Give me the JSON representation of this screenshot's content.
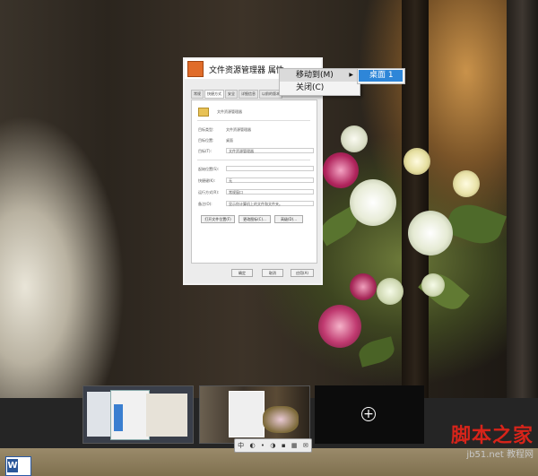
{
  "window": {
    "title": "文件资源管理器 属性",
    "tabs": [
      "常规",
      "快捷方式",
      "安全",
      "详细信息",
      "以前的版本"
    ],
    "app_name": "文件资源管理器",
    "fields": [
      {
        "label": "目标类型:",
        "value": "文件资源管理器"
      },
      {
        "label": "目标位置:",
        "value": "桌面"
      },
      {
        "label": "目标(T):",
        "value": "文件资源管理器"
      },
      {
        "label": "起始位置(S):",
        "value": ""
      },
      {
        "label": "快捷键(K):",
        "value": "无"
      },
      {
        "label": "运行方式(R):",
        "value": "常规窗口"
      },
      {
        "label": "备注(O):",
        "value": "显示你计算机上的文件和文件夹。"
      }
    ],
    "action_buttons": [
      "打开文件位置(F)",
      "更改图标(C)...",
      "高级(D)..."
    ],
    "dialog_buttons": [
      "确定",
      "取消",
      "应用(A)"
    ]
  },
  "context_menu": {
    "items": [
      {
        "label": "移动到(M)",
        "has_submenu": true
      },
      {
        "label": "关闭(C)",
        "has_submenu": false
      }
    ],
    "submenu": {
      "items": [
        "桌面 1"
      ],
      "selected_color": "#2e86d8"
    }
  },
  "desktops": {
    "add_label": "+"
  },
  "taskbar": {
    "word_label": "W",
    "mini_controls": [
      "中",
      "◐",
      "•",
      "◑",
      "▪",
      "▦",
      "✉"
    ]
  },
  "watermark": {
    "main": "脚本之家",
    "sub": "jb51.net 教程网"
  }
}
